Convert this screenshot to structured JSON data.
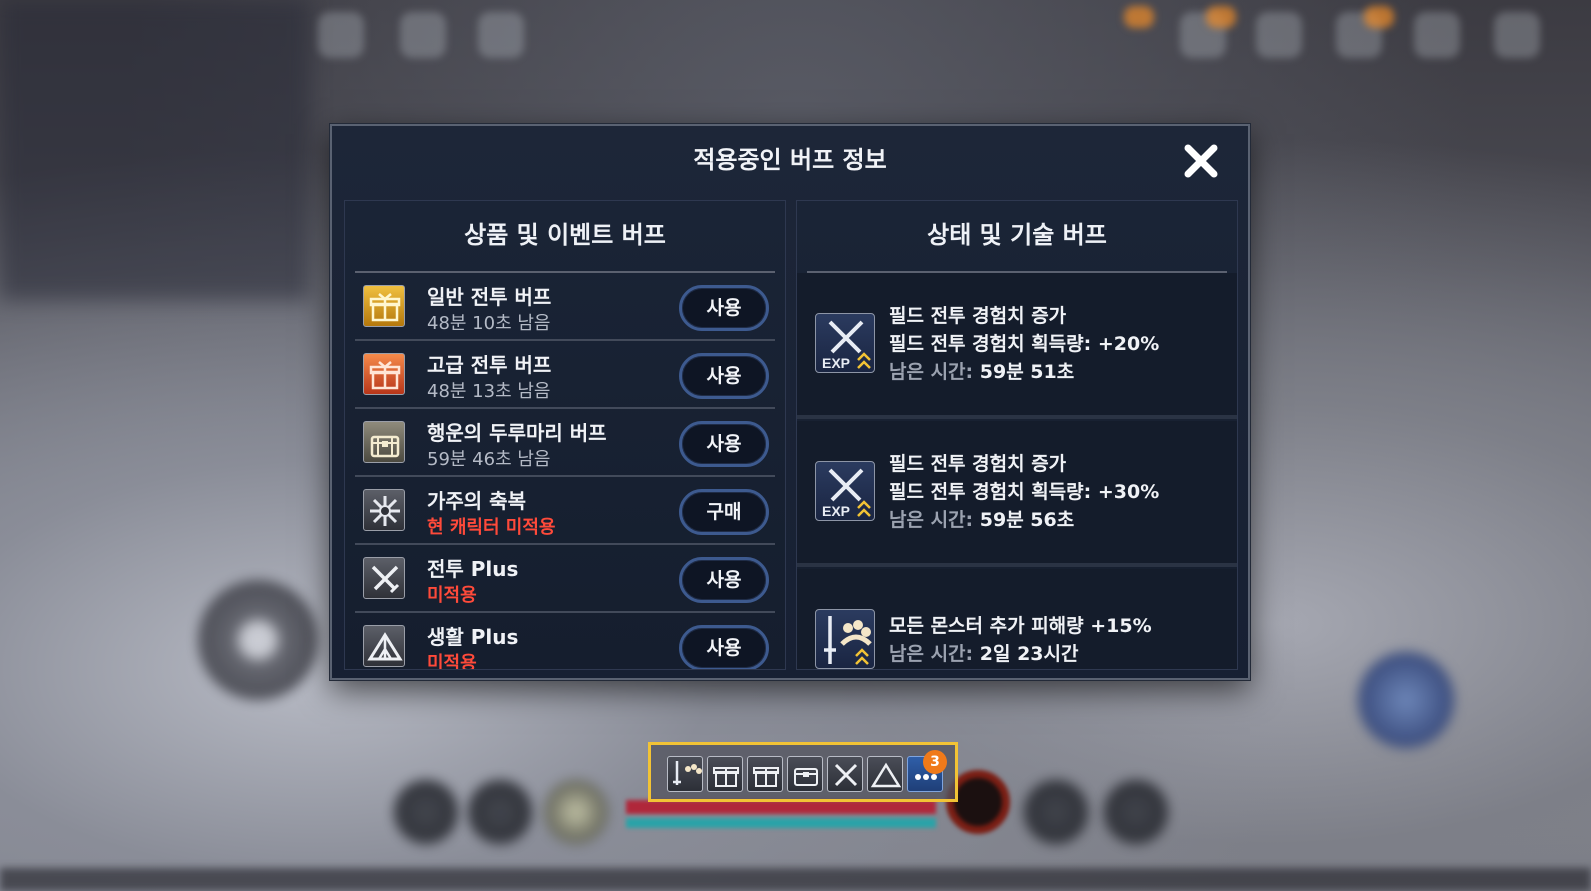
{
  "dialog": {
    "title": "적용중인 버프 정보",
    "close_icon": "close-icon"
  },
  "left_panel": {
    "header": "상품 및 이벤트 버프",
    "items": [
      {
        "name": "일반 전투 버프",
        "sub": "48분 10초 남음",
        "button": "사용",
        "icon": "gold-gift-box-icon",
        "icon_color": "#d9a21a"
      },
      {
        "name": "고급 전투 버프",
        "sub": "48분 13초 남음",
        "button": "사용",
        "icon": "orange-gift-box-icon",
        "icon_color": "#e0552a"
      },
      {
        "name": "행운의 두루마리 버프",
        "sub": "59분 46초 남음",
        "button": "사용",
        "icon": "treasure-chest-icon",
        "icon_color": "#6e6a5e"
      },
      {
        "name": "가주의 축복",
        "sub": "현 캐릭터 미적용",
        "button": "구매",
        "icon": "starburst-icon",
        "icon_color": "#4a4d56"
      },
      {
        "name": "전투 Plus",
        "sub": "미적용",
        "button": "사용",
        "icon": "crossed-swords-icon",
        "icon_color": "#4a4d56"
      },
      {
        "name": "생활 Plus",
        "sub": "미적용",
        "button": "사용",
        "icon": "camp-tent-icon",
        "icon_color": "#4a4d56"
      }
    ]
  },
  "right_panel": {
    "header": "상태 및 기술 버프",
    "buffs": [
      {
        "title": "필드 전투 경험치 증가",
        "detail": "필드 전투 경험치 획득량: +20%",
        "time_label": "남은 시간:",
        "time_value": "59분 51초",
        "icon": "exp-swords-icon",
        "icon_text": "EXP"
      },
      {
        "title": "필드 전투 경험치 증가",
        "detail": "필드 전투 경험치 획득량: +30%",
        "time_label": "남은 시간:",
        "time_value": "59분 56초",
        "icon": "exp-swords-icon",
        "icon_text": "EXP"
      },
      {
        "title": "모든 몬스터 추가 피해량 +15%",
        "time_label": "남은 시간:",
        "time_value": "2일 23시간",
        "icon": "sword-monster-damage-icon"
      }
    ]
  },
  "quickbar": {
    "badge": "3",
    "slots": [
      "sword-monster-damage-icon",
      "gold-gift-box-icon",
      "orange-gift-box-icon",
      "treasure-chest-icon",
      "crossed-swords-icon",
      "camp-tent-icon",
      "more-dots-icon"
    ],
    "highlight_color": "#f2c335"
  },
  "colors": {
    "accent_red": "#ff4a3a",
    "button_border": "#3d5a8f",
    "dialog_bg": "#1d2638"
  }
}
